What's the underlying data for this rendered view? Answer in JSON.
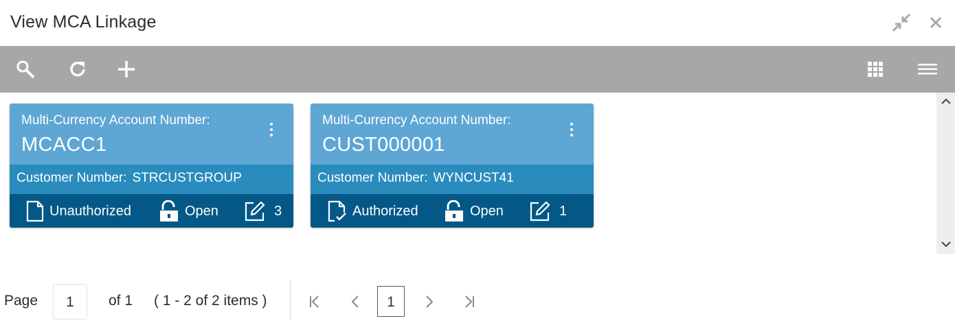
{
  "window": {
    "title": "View MCA Linkage",
    "icons": [
      "minimize-icon",
      "close-icon"
    ]
  },
  "toolbar": {
    "left_icons": [
      "search-icon",
      "refresh-icon",
      "add-icon"
    ],
    "right_icons": [
      "grid-view-icon",
      "list-view-icon"
    ]
  },
  "cards": [
    {
      "label": "Multi-Currency Account Number:",
      "account": "MCACC1",
      "customer_label": "Customer Number:",
      "customer_value": "STRCUSTGROUP",
      "auth_status": "Unauthorized",
      "record_status": "Open",
      "mod_count": "3"
    },
    {
      "label": "Multi-Currency Account Number:",
      "account": "CUST000001",
      "customer_label": "Customer Number:",
      "customer_value": "WYNCUST41",
      "auth_status": "Authorized",
      "record_status": "Open",
      "mod_count": "1"
    }
  ],
  "pager": {
    "page_label": "Page",
    "page_value": "1",
    "of_label": "of 1",
    "items_label": "( 1 - 2 of 2 items )",
    "current_page": "1"
  },
  "colors": {
    "toolbar": "#a7a7a7",
    "card_head": "#5ea6d4",
    "card_mid": "#2a8bbd",
    "card_foot": "#035887"
  }
}
